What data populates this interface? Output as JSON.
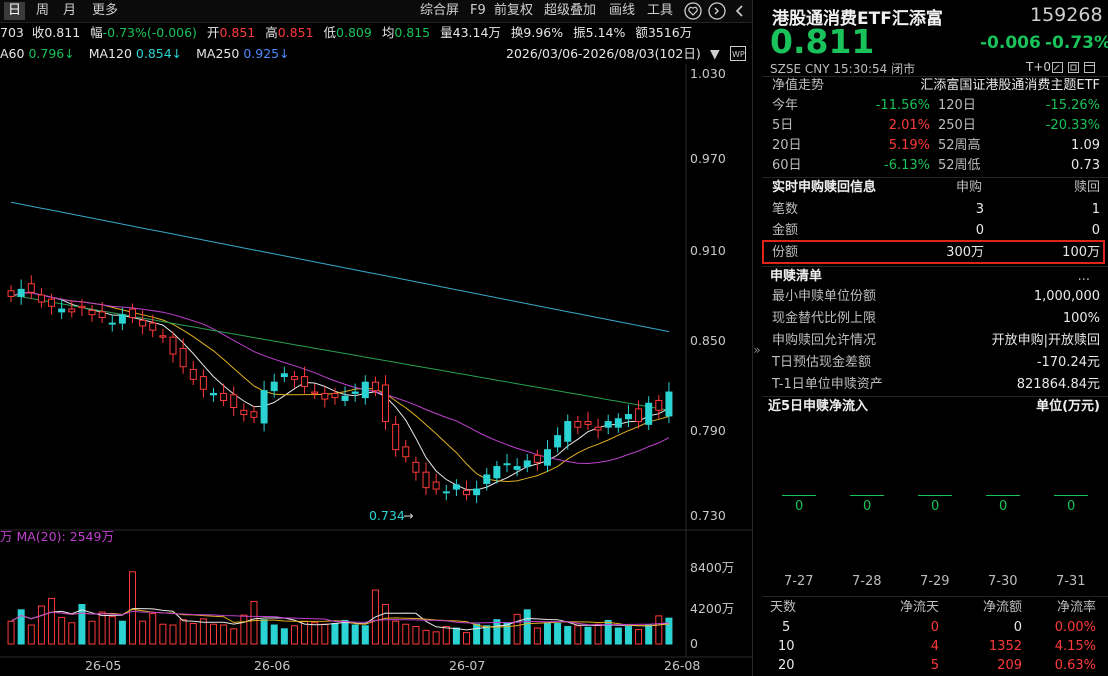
{
  "toolbar": {
    "tabs": [
      "日",
      "周",
      "月",
      "更多"
    ],
    "tools": [
      "综合屏",
      "F9",
      "前复权",
      "超级叠加",
      "画线",
      "工具"
    ],
    "icons": [
      "heart-icon",
      "back-icon"
    ]
  },
  "info": {
    "code_fragment": "703",
    "close_label": "收",
    "close": "0.811",
    "amp_label": "幅",
    "amp": "-0.73%(-0.006)",
    "open_label": "开",
    "open": "0.851",
    "high_label": "高",
    "high": "0.851",
    "low_label": "低",
    "low": "0.809",
    "avg_label": "均",
    "avg": "0.815",
    "vol_label": "量",
    "vol": "43.14万",
    "turn_label": "换",
    "turn": "9.96%",
    "swing_label": "振",
    "swing": "5.14%",
    "amount_label": "额",
    "amount": "3516万"
  },
  "ma": {
    "ma60_label": "A60",
    "ma60": "0.796↓",
    "ma120_label": "MA120",
    "ma120": "0.854↓",
    "ma250_label": "MA250",
    "ma250": "0.925↓",
    "range": "2026/03/06-2026/08/03(102日)"
  },
  "chart": {
    "price_ticks": [
      "1.030",
      "0.970",
      "0.910",
      "0.850",
      "0.790",
      "0.730"
    ],
    "low_marker": "0.734",
    "vol_legend": "万 MA(20): 2549万",
    "vol_ticks": [
      "8400万",
      "4200万",
      "0"
    ],
    "dates": [
      "26-05",
      "26-06",
      "26-07",
      "26-08"
    ]
  },
  "chart_data": {
    "type": "candlestick",
    "colors": {
      "up": "#2bd3d3",
      "down": "#ff3a3a",
      "ma5": "#e8e8e8",
      "ma10": "#e0b020",
      "ma20": "#c040d0",
      "ma60": "#28a050",
      "ma120": "#38a8c8"
    },
    "ylim": [
      0.72,
      1.04
    ],
    "closes": [
      0.879,
      0.884,
      0.882,
      0.875,
      0.872,
      0.87,
      0.868,
      0.871,
      0.866,
      0.864,
      0.86,
      0.866,
      0.864,
      0.858,
      0.855,
      0.85,
      0.838,
      0.829,
      0.82,
      0.813,
      0.81,
      0.805,
      0.8,
      0.795,
      0.793,
      0.812,
      0.818,
      0.824,
      0.82,
      0.815,
      0.81,
      0.806,
      0.807,
      0.808,
      0.811,
      0.818,
      0.812,
      0.79,
      0.77,
      0.765,
      0.754,
      0.743,
      0.742,
      0.74,
      0.745,
      0.738,
      0.742,
      0.752,
      0.758,
      0.76,
      0.758,
      0.762,
      0.761,
      0.77,
      0.78,
      0.79,
      0.786,
      0.788,
      0.784,
      0.79,
      0.792,
      0.795,
      0.79,
      0.803,
      0.798,
      0.811
    ],
    "volumes_wan": [
      3000,
      4500,
      2500,
      5000,
      6000,
      3500,
      2800,
      5200,
      3000,
      4200,
      3600,
      3000,
      9500,
      3000,
      4000,
      2600,
      2500,
      3200,
      2700,
      3300,
      2600,
      2500,
      2000,
      3800,
      5600,
      3200,
      2500,
      2000,
      2400,
      3000,
      2800,
      2600,
      2700,
      3100,
      2500,
      2400,
      7100,
      5200,
      3000,
      2600,
      2300,
      1800,
      1600,
      2300,
      2100,
      1500,
      2600,
      2400,
      3200,
      2800,
      3900,
      4500,
      2100,
      2800,
      2700,
      2300,
      2400,
      2200,
      2600,
      3100,
      2100,
      2300,
      1900,
      2500,
      3700,
      3400
    ]
  },
  "quote": {
    "name": "港股通消费ETF汇添富",
    "code": "159268",
    "price": "0.811",
    "change": "-0.006",
    "change_pct": "-0.73%",
    "market": "SZSE",
    "currency": "CNY",
    "time": "15:30:54",
    "status": "闭市",
    "t0": "T+0"
  },
  "nav": {
    "title": "净值走势",
    "index_name": "汇添富国证港股通消费主题ETF",
    "rows": [
      {
        "l1": "今年",
        "v1": "-11.56%",
        "c1": "green",
        "l2": "120日",
        "v2": "-15.26%",
        "c2": "green"
      },
      {
        "l1": "5日",
        "v1": "2.01%",
        "c1": "red",
        "l2": "250日",
        "v2": "-20.33%",
        "c2": "green"
      },
      {
        "l1": "20日",
        "v1": "5.19%",
        "c1": "red",
        "l2": "52周高",
        "v2": "1.09",
        "c2": "val"
      },
      {
        "l1": "60日",
        "v1": "-6.13%",
        "c1": "green",
        "l2": "52周低",
        "v2": "0.73",
        "c2": "val"
      }
    ]
  },
  "realtime": {
    "title": "实时申购赎回信息",
    "col_buy": "申购",
    "col_redeem": "赎回",
    "rows": [
      {
        "label": "笔数",
        "buy": "3",
        "redeem": "1"
      },
      {
        "label": "金额",
        "buy": "0",
        "redeem": "0"
      },
      {
        "label": "份额",
        "buy": "300万",
        "redeem": "100万"
      }
    ]
  },
  "list": {
    "title": "申赎清单",
    "more": "...",
    "rows": [
      {
        "label": "最小申赎单位份额",
        "value": "1,000,000"
      },
      {
        "label": "现金替代比例上限",
        "value": "100%"
      },
      {
        "label": "申购赎回允许情况",
        "value": "开放申购|开放赎回"
      },
      {
        "label": "T日预估现金差额",
        "value": "-170.24元"
      },
      {
        "label": "T-1日单位申赎资产",
        "value": "821864.84元"
      }
    ]
  },
  "inflow5": {
    "title": "近5日申赎净流入",
    "unit": "单位(万元)",
    "values": [
      "0",
      "0",
      "0",
      "0",
      "0"
    ],
    "dates": [
      "7-27",
      "7-28",
      "7-29",
      "7-30",
      "7-31"
    ]
  },
  "flowtable": {
    "headers": [
      "天数",
      "净流天",
      "净流额",
      "净流率"
    ],
    "rows": [
      {
        "days": "5",
        "flow_days": "0",
        "flow_amt": "0",
        "flow_rate": "0.00%"
      },
      {
        "days": "10",
        "flow_days": "4",
        "flow_amt": "1352",
        "flow_rate": "4.15%"
      },
      {
        "days": "20",
        "flow_days": "5",
        "flow_amt": "209",
        "flow_rate": "0.63%"
      }
    ]
  }
}
